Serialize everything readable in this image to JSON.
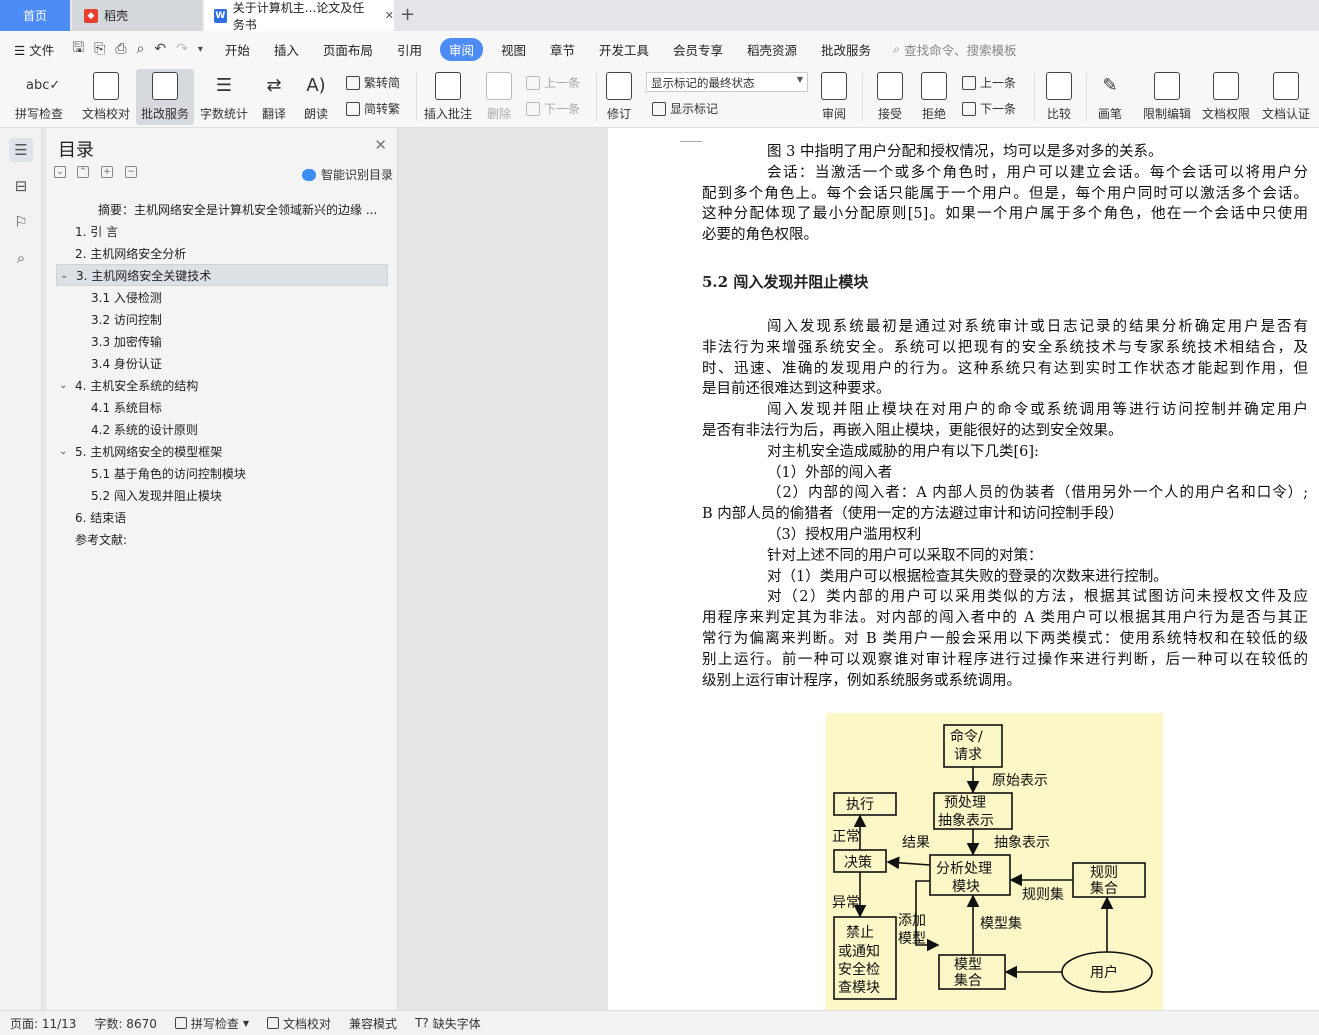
{
  "tabs": [
    {
      "label": "首页"
    },
    {
      "label": "稻壳"
    },
    {
      "label": "关于计算机主...论文及任务书"
    }
  ],
  "menu": {
    "file": "文件",
    "items": [
      "开始",
      "插入",
      "页面布局",
      "引用",
      "审阅",
      "视图",
      "章节",
      "开发工具",
      "会员专享",
      "稻壳资源",
      "批改服务"
    ],
    "search_placeholder": "查找命令、搜索模板"
  },
  "ribbon": {
    "spell": "拼写检查",
    "proofread": "文档校对",
    "correction": "批改服务",
    "wordcount": "字数统计",
    "translate": "翻译",
    "read": "朗读",
    "trad_to_simp": "繁转简",
    "simp_to_trad": "简转繁",
    "insert_comment": "插入批注",
    "delete": "删除",
    "prev1": "上一条",
    "next1": "下一条",
    "revise": "修订",
    "markup_state": "显示标记的最终状态",
    "show_markup": "显示标记",
    "review": "审阅",
    "accept": "接受",
    "reject": "拒绝",
    "prev2": "上一条",
    "next2": "下一条",
    "compare": "比较",
    "pen": "画笔",
    "restrict": "限制编辑",
    "permission": "文档权限",
    "certify": "文档认证"
  },
  "toc": {
    "title": "目录",
    "smart": "智能识别目录",
    "items": [
      {
        "label": "摘要：主机网络安全是计算机安全领域新兴的边缘 ...",
        "level": 0
      },
      {
        "label": "1.  引  言",
        "level": 1
      },
      {
        "label": "2.  主机网络安全分析",
        "level": 1
      },
      {
        "label": "3.  主机网络安全关键技术",
        "level": 1,
        "expanded": true,
        "selected": true
      },
      {
        "label": "3.1    入侵检测",
        "level": 2
      },
      {
        "label": "3.2    访问控制",
        "level": 2
      },
      {
        "label": "3.3    加密传输",
        "level": 2
      },
      {
        "label": "3.4    身份认证",
        "level": 2
      },
      {
        "label": "4.  主机安全系统的结构",
        "level": 1,
        "expanded": true
      },
      {
        "label": "4.1 系统目标",
        "level": 2
      },
      {
        "label": "4.2 系统的设计原则",
        "level": 2
      },
      {
        "label": "5.  主机网络安全的模型框架",
        "level": 1,
        "expanded": true
      },
      {
        "label": "5.1  基于角色的访问控制模块",
        "level": 2
      },
      {
        "label": "5.2  闯入发现并阻止模块",
        "level": 2
      },
      {
        "label": "6.  结束语",
        "level": 1
      },
      {
        "label": "参考文献:",
        "level": 1
      }
    ]
  },
  "doc": {
    "heading": "5.2  闯入发现并阻止模块",
    "lines_top": [
      {
        "text": "图 3 中指明了用户分配和授权情况，均可以是多对多的关系。",
        "indent": true,
        "just": false
      },
      {
        "text": "会话：当激活一个或多个角色时，用户可以建立会话。每个会话可以将用户分",
        "indent": true,
        "just": true
      },
      {
        "text": "配到多个角色上。每个会话只能属于一个用户。但是，每个用户同时可以激活多个会话。",
        "indent": false,
        "just": true
      },
      {
        "text": "这种分配体现了最小分配原则[5]。如果一个用户属于多个角色，他在一个会话中只使用",
        "indent": false,
        "just": true
      },
      {
        "text": "必要的角色权限。",
        "indent": false,
        "just": false
      }
    ],
    "lines_body": [
      {
        "text": "闯入发现系统最初是通过对系统审计或日志记录的结果分析确定用户是否有",
        "indent": true,
        "just": true
      },
      {
        "text": "非法行为来增强系统安全。系统可以把现有的安全系统技术与专家系统技术相结合，及",
        "indent": false,
        "just": true
      },
      {
        "text": "时、迅速、准确的发现用户的行为。这种系统只有达到实时工作状态才能起到作用，但",
        "indent": false,
        "just": true
      },
      {
        "text": "是目前还很难达到这种要求。",
        "indent": false,
        "just": false
      },
      {
        "text": "闯入发现并阻止模块在对用户的命令或系统调用等进行访问控制并确定用户",
        "indent": true,
        "just": true
      },
      {
        "text": "是否有非法行为后，再嵌入阻止模块，更能很好的达到安全效果。",
        "indent": false,
        "just": false
      },
      {
        "text": "对主机安全造成威胁的用户有以下几类[6]:",
        "indent": true,
        "just": false
      },
      {
        "text": "（1）外部的闯入者",
        "indent": true,
        "just": false
      },
      {
        "text": "（2）内部的闯入者：A 内部人员的伪装者（借用另外一个人的用户名和口令）;",
        "indent": true,
        "just": true
      },
      {
        "text": "B 内部人员的偷猎者（使用一定的方法避过审计和访问控制手段）",
        "indent": false,
        "just": false
      },
      {
        "text": "（3）授权用户滥用权利",
        "indent": true,
        "just": false
      },
      {
        "text": "针对上述不同的用户可以采取不同的对策：",
        "indent": true,
        "just": false
      },
      {
        "text": "对（1）类用户可以根据检查其失败的登录的次数来进行控制。",
        "indent": true,
        "just": false
      },
      {
        "text": "对（2）类内部的用户可以采用类似的方法，根据其试图访问未授权文件及应",
        "indent": true,
        "just": true
      },
      {
        "text": "用程序来判定其为非法。对内部的闯入者中的 A 类用户可以根据其用户行为是否与其正",
        "indent": false,
        "just": true
      },
      {
        "text": "常行为偏离来判断。对 B 类用户一般会采用以下两类模式：使用系统特权和在较低的级",
        "indent": false,
        "just": true
      },
      {
        "text": "别上运行。前一种可以观察谁对审计程序进行过操作来进行判断，后一种可以在较低的",
        "indent": false,
        "just": true
      },
      {
        "text": "级别上运行审计程序，例如系统服务或系统调用。",
        "indent": false,
        "just": false
      }
    ],
    "figure": {
      "cmd": [
        "命令/",
        "请求"
      ],
      "raw": "原始表示",
      "exec": "执行",
      "pre": [
        "预处理",
        "抽象表示"
      ],
      "normal": "正常",
      "result": "结果",
      "abstract": "抽象表示",
      "decide": "决策",
      "analyze": [
        "分析处理",
        "模块"
      ],
      "rules": [
        "规则",
        "集合"
      ],
      "ruleset": "规则集",
      "abnormal": "异常",
      "block": [
        "禁止",
        "或通知",
        "安全检",
        "查模块"
      ],
      "addmodel": [
        "添加",
        "模型"
      ],
      "modelset": "模型集",
      "model": [
        "模型",
        "集合"
      ],
      "user": "用户"
    }
  },
  "status": {
    "page": "页面: 11/13",
    "words": "字数: 8670",
    "spell": "拼写检查",
    "proof": "文档校对",
    "compat": "兼容模式",
    "font": "缺失字体"
  },
  "colors": {
    "accent": "#4d8cf5",
    "figure_bg": "#fbf7c6"
  }
}
